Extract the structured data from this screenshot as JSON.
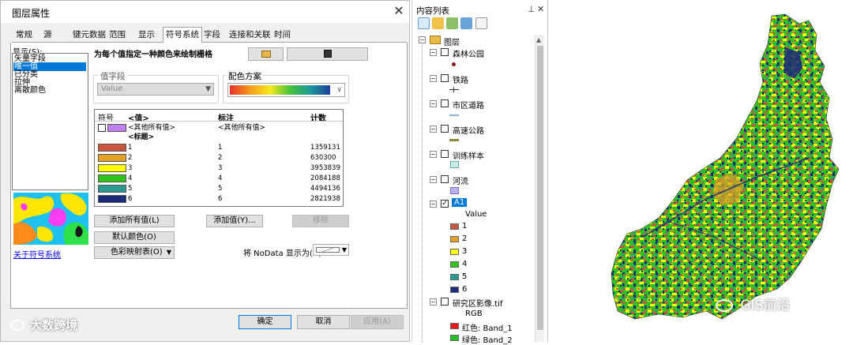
{
  "dialog": {
    "title": "图层属性",
    "close_glyph": "✕",
    "tabs": [
      "常规",
      "源",
      "键元数据",
      "范围",
      "显示",
      "符号系统",
      "字段",
      "连接和关联",
      "时间"
    ],
    "active_tab_index": 5,
    "show_label": "显示(S):",
    "show_items": [
      "矢量字段",
      "唯一值",
      "已分类",
      "拉伸",
      "离散颜色"
    ],
    "show_selected_index": 1,
    "heading": "为每个值指定一种颜色来绘制栅格",
    "value_field_label": "值字段",
    "value_field_value": "Value",
    "color_scheme_label": "配色方案",
    "columns": [
      "符号",
      "<值>",
      "标注",
      "计数"
    ],
    "other_row": {
      "value": "<其他所有值>",
      "label": "<其他所有值>",
      "color": "#c080f0"
    },
    "heading_row": "<标题>",
    "rows": [
      {
        "value": "1",
        "label": "1",
        "count": "1359131",
        "color": "#c8553d"
      },
      {
        "value": "2",
        "label": "2",
        "count": "630300",
        "color": "#e3a028"
      },
      {
        "value": "3",
        "label": "3",
        "count": "3953839",
        "color": "#ffff00"
      },
      {
        "value": "4",
        "label": "4",
        "count": "2084188",
        "color": "#2ec21a"
      },
      {
        "value": "5",
        "label": "5",
        "count": "4494136",
        "color": "#2a9a8e"
      },
      {
        "value": "6",
        "label": "6",
        "count": "2821938",
        "color": "#1b2a78"
      }
    ],
    "add_all_values": "添加所有值(L)",
    "add_values": "添加值(Y)...",
    "remove": "移除",
    "default_colors": "默认颜色(O)",
    "colormap": "色彩映射表(O)",
    "nodata_label": "将 NoData 显示为(N)",
    "about_link": "关于符号系统",
    "ok": "确定",
    "cancel": "取消",
    "apply": "应用(A)"
  },
  "toc": {
    "title": "内容列表",
    "pin_glyph": "⊥",
    "close_glyph": "✕",
    "root": "图层",
    "layers": [
      {
        "name": "森林公园",
        "checked": false
      },
      {
        "name": "铁路",
        "checked": false
      },
      {
        "name": "市区道路",
        "checked": false
      },
      {
        "name": "高速公路",
        "checked": false
      },
      {
        "name": "训练样本",
        "checked": false
      },
      {
        "name": "河流",
        "checked": false
      },
      {
        "name": "A1",
        "checked": true
      },
      {
        "name": "研究区影像.tif",
        "checked": false
      }
    ],
    "a1_field": "Value",
    "a1_classes": [
      "1",
      "2",
      "3",
      "4",
      "5",
      "6"
    ],
    "rgb_label": "RGB",
    "band1": "红色:   Band_1",
    "band2": "绿色:   Band_2"
  },
  "watermarks": {
    "left": "大数跨境",
    "right": "GIS前沿"
  },
  "colors": {
    "selection_blue": "#0078d7",
    "cls1": "#c8553d",
    "cls2": "#e3a028",
    "cls3": "#ffff00",
    "cls4": "#2ec21a",
    "cls5": "#2a9a8e",
    "cls6": "#1b2a78"
  }
}
